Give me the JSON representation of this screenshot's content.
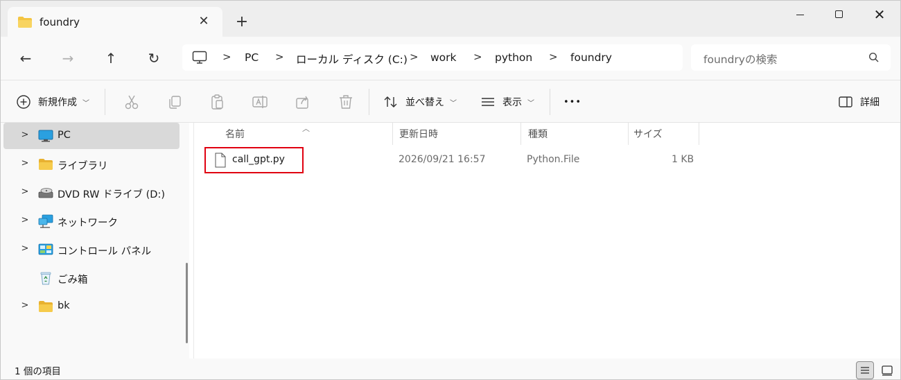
{
  "window": {
    "tab_title": "foundry",
    "tab_close": "✕",
    "new_tab": "+",
    "close_glyph": "✕"
  },
  "nav": {
    "back": "←",
    "forward": "→",
    "up": "↑",
    "refresh": "↻"
  },
  "breadcrumb": [
    "PC",
    "ローカル ディスク (C:)",
    "work",
    "python",
    "foundry"
  ],
  "breadcrumb_separator": ">",
  "search": {
    "placeholder": "foundryの検索"
  },
  "toolbar": {
    "new_label": "新規作成",
    "sort_label": "並べ替え",
    "view_label": "表示",
    "more_label": "•••",
    "details_label": "詳細"
  },
  "sidebar": {
    "items": [
      {
        "label": "PC",
        "icon": "monitor-icon",
        "expandable": true,
        "selected": true
      },
      {
        "label": "ライブラリ",
        "icon": "folder-icon",
        "expandable": true,
        "selected": false
      },
      {
        "label": "DVD RW ドライブ (D:)",
        "icon": "dvd-drive-icon",
        "expandable": true,
        "selected": false
      },
      {
        "label": "ネットワーク",
        "icon": "network-icon",
        "expandable": true,
        "selected": false
      },
      {
        "label": "コントロール パネル",
        "icon": "control-panel-icon",
        "expandable": true,
        "selected": false
      },
      {
        "label": "ごみ箱",
        "icon": "recycle-bin-icon",
        "expandable": false,
        "selected": false
      },
      {
        "label": "bk",
        "icon": "folder-icon",
        "expandable": true,
        "selected": false
      }
    ]
  },
  "file_list": {
    "columns": [
      "名前",
      "更新日時",
      "種類",
      "サイズ"
    ],
    "rows": [
      {
        "name": "call_gpt.py",
        "modified": "2026/09/21 16:57",
        "type": "Python.File",
        "size": "1 KB"
      }
    ]
  },
  "status": {
    "item_count": "1 個の項目"
  },
  "colors": {
    "highlight_border": "#e00010",
    "folder_yellow": "#f4c542",
    "monitor_blue": "#2aa0e0"
  }
}
